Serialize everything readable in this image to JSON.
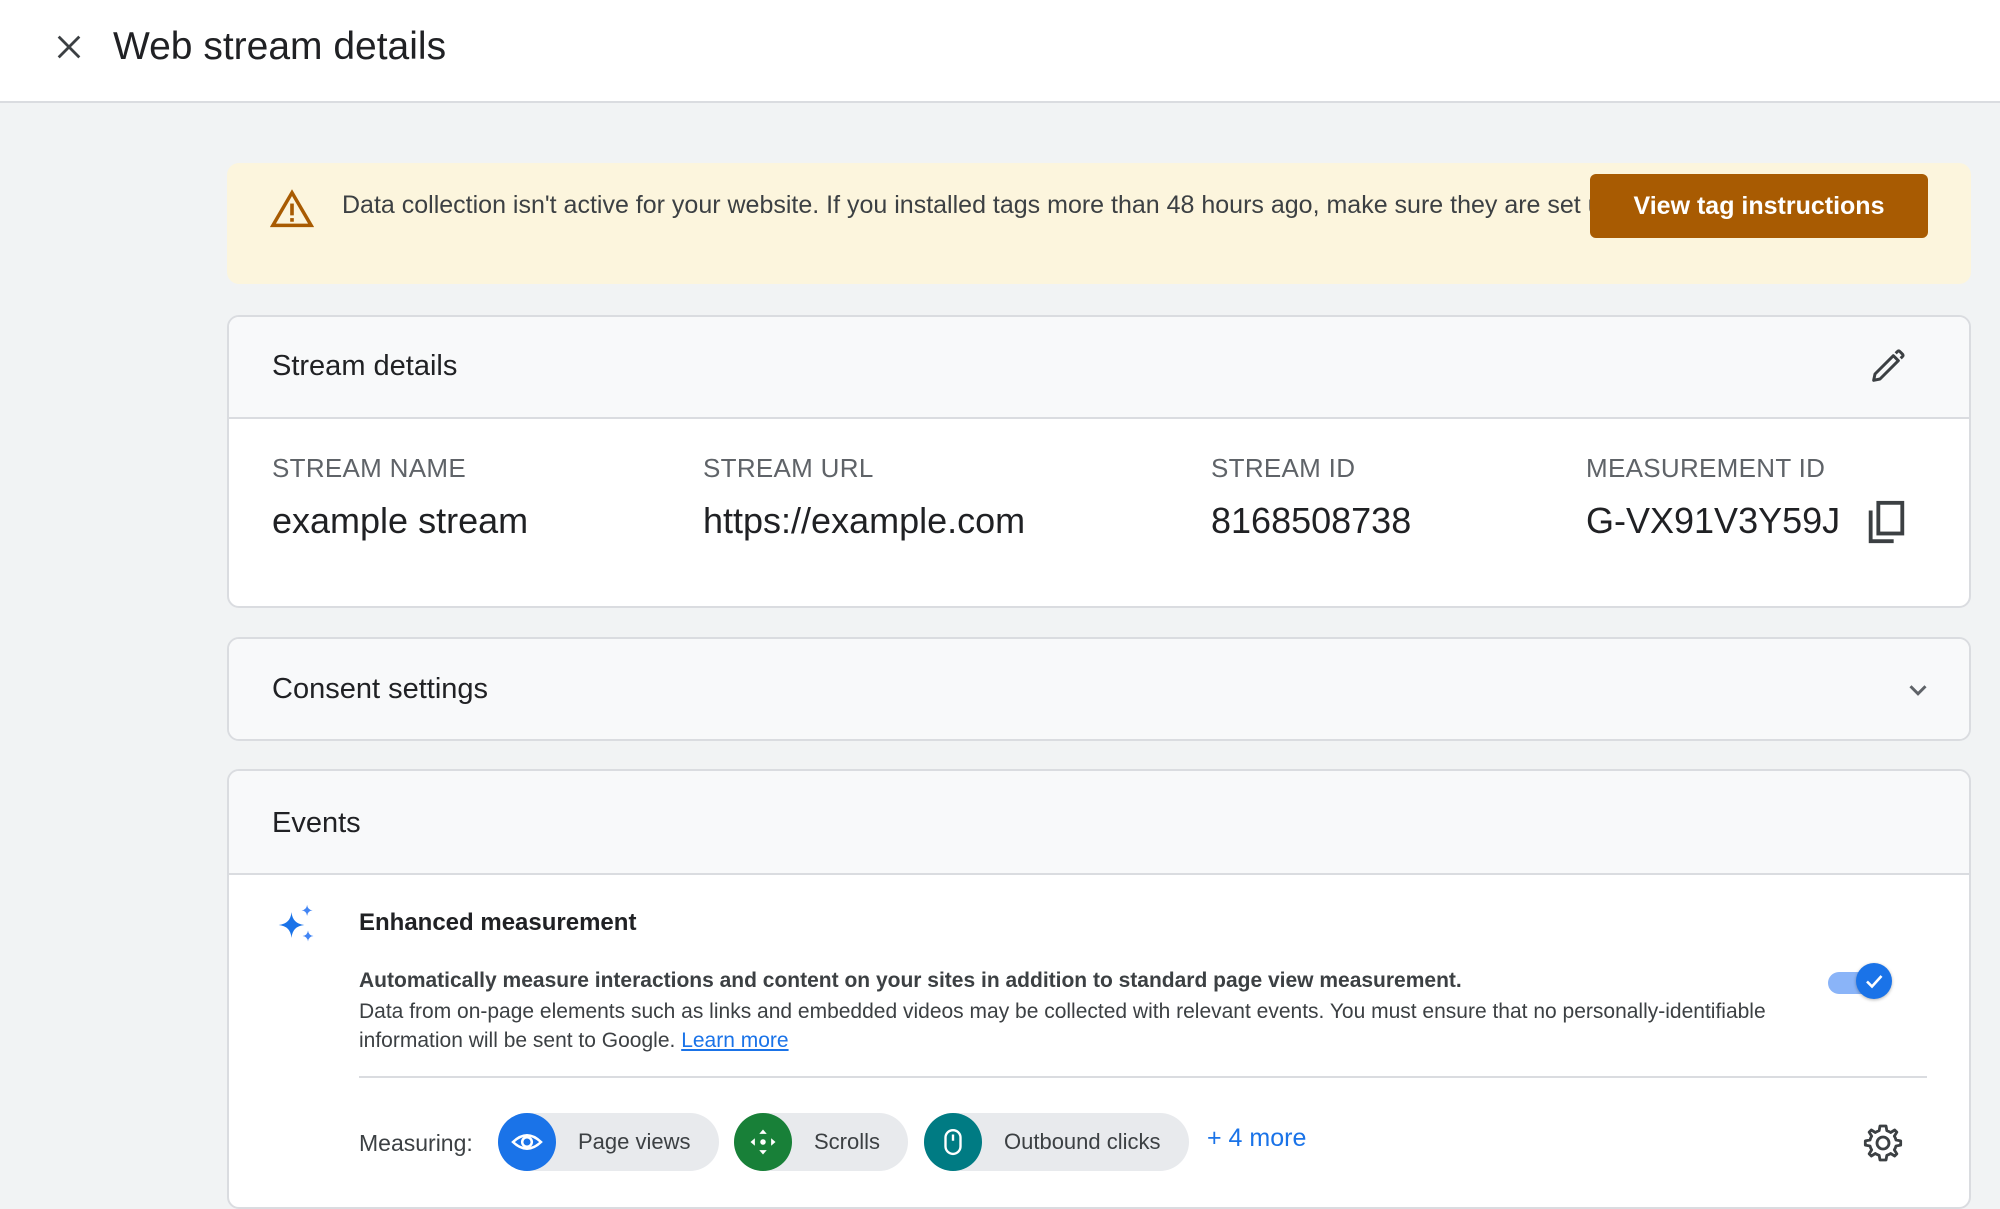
{
  "header": {
    "title": "Web stream details",
    "close_icon": "close-icon"
  },
  "banner": {
    "icon": "warning-icon",
    "message": "Data collection isn't active for your website. If you installed tags more than 48 hours ago, make sure they are set up correctly.",
    "button_label": "View tag instructions",
    "colors": {
      "background": "#fcf5dd",
      "button": "#a85b02",
      "icon": "#a85b02"
    }
  },
  "stream_details": {
    "title": "Stream details",
    "edit_icon": "pencil-icon",
    "fields": {
      "stream_name": {
        "label": "STREAM NAME",
        "value": "example stream"
      },
      "stream_url": {
        "label": "STREAM URL",
        "value": "https://example.com"
      },
      "stream_id": {
        "label": "STREAM ID",
        "value": "8168508738"
      },
      "measurement_id": {
        "label": "MEASUREMENT ID",
        "value": "G-VX91V3Y59J"
      }
    },
    "copy_icon": "copy-icon"
  },
  "consent": {
    "title": "Consent settings",
    "expand_icon": "chevron-down-icon"
  },
  "events": {
    "title": "Events",
    "enhanced": {
      "icon": "sparkle-icon",
      "title": "Enhanced measurement",
      "summary": "Automatically measure interactions and content on your sites in addition to standard page view measurement.",
      "description": "Data from on-page elements such as links and embedded videos may be collected with relevant events. You must ensure that no personally-identifiable information will be sent to Google.",
      "learn_more": "Learn more",
      "toggle_on": true
    },
    "measuring": {
      "label": "Measuring:",
      "chips": [
        {
          "label": "Page views",
          "icon": "eye-icon",
          "color": "#1a73e8"
        },
        {
          "label": "Scrolls",
          "icon": "move-arrows-icon",
          "color": "#188038"
        },
        {
          "label": "Outbound clicks",
          "icon": "mouse-icon",
          "color": "#007b83"
        }
      ],
      "more": "+ 4 more",
      "settings_icon": "gear-icon"
    }
  }
}
